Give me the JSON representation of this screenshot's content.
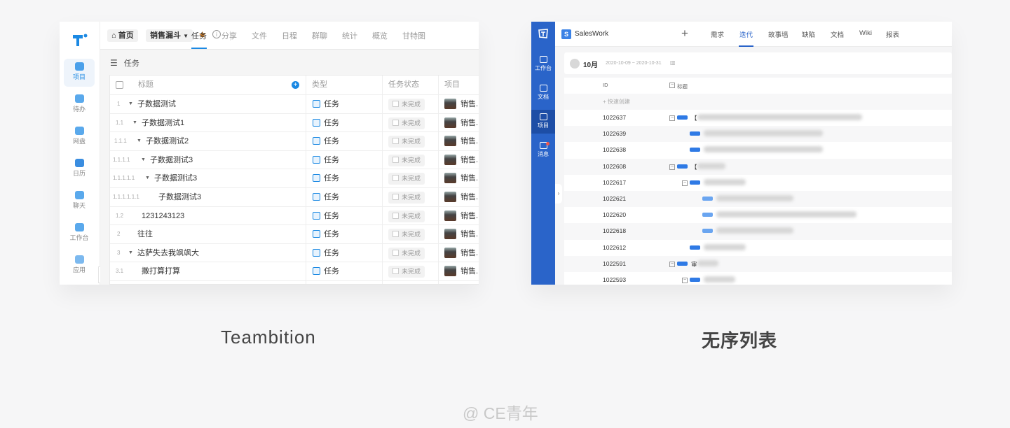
{
  "teambition": {
    "caption": "Teambition",
    "top": {
      "home_label": "首页",
      "project_label": "销售漏斗",
      "tabs": [
        "任务",
        "分享",
        "文件",
        "日程",
        "群聊",
        "统计",
        "概览",
        "甘特图"
      ],
      "active_tab": "任务"
    },
    "sidebar": [
      {
        "label": "项目",
        "icon": "cube-icon",
        "active": true
      },
      {
        "label": "待办",
        "icon": "clipboard-icon"
      },
      {
        "label": "网盘",
        "icon": "folder-icon"
      },
      {
        "label": "日历",
        "icon": "calendar-icon"
      },
      {
        "label": "聊天",
        "icon": "chat-icon"
      },
      {
        "label": "工作台",
        "icon": "monitor-icon"
      },
      {
        "label": "应用",
        "icon": "apps-icon"
      }
    ],
    "subheader": "任务",
    "table": {
      "columns": [
        "标题",
        "类型",
        "任务状态",
        "项目"
      ],
      "rows": [
        {
          "num": "1",
          "expand": true,
          "indent": 0,
          "title": "子数据测试",
          "type": "任务",
          "status": "未完成",
          "project": "销售.."
        },
        {
          "num": "1.1",
          "expand": true,
          "indent": 1,
          "title": "子数据测试1",
          "type": "任务",
          "status": "未完成",
          "project": "销售.."
        },
        {
          "num": "1.1.1",
          "expand": true,
          "indent": 2,
          "title": "子数据测试2",
          "type": "任务",
          "status": "未完成",
          "project": "销售.."
        },
        {
          "num": "1.1.1.1",
          "expand": true,
          "indent": 3,
          "title": "子数据测试3",
          "type": "任务",
          "status": "未完成",
          "project": "销售.."
        },
        {
          "num": "1.1.1.1.1",
          "expand": true,
          "indent": 4,
          "title": "子数据测试3",
          "type": "任务",
          "status": "未完成",
          "project": "销售.."
        },
        {
          "num": "1.1.1.1.1.1",
          "expand": false,
          "indent": 5,
          "title": "子数据测试3",
          "type": "任务",
          "status": "未完成",
          "project": "销售.."
        },
        {
          "num": "1.2",
          "expand": false,
          "indent": 1,
          "title": "1231243123",
          "type": "任务",
          "status": "未完成",
          "project": "销售.."
        },
        {
          "num": "2",
          "expand": false,
          "indent": 0,
          "title": "往往",
          "type": "任务",
          "status": "未完成",
          "project": "销售.."
        },
        {
          "num": "3",
          "expand": true,
          "indent": 0,
          "title": "达萨失去我飒飒大",
          "type": "任务",
          "status": "未完成",
          "project": "销售.."
        },
        {
          "num": "3.1",
          "expand": false,
          "indent": 1,
          "title": "撒打算打算",
          "type": "任务",
          "status": "未完成",
          "project": "销售.."
        }
      ]
    }
  },
  "saleswork": {
    "caption": "无序列表",
    "app_letter": "S",
    "app_name": "SalesWork",
    "tabs": [
      "需求",
      "迭代",
      "故事墙",
      "缺陷",
      "文档",
      "Wiki",
      "报表"
    ],
    "active_tab": "迭代",
    "sidebar": [
      {
        "label": "工作台",
        "icon": "archive-icon"
      },
      {
        "label": "文档",
        "icon": "document-icon"
      },
      {
        "label": "项目",
        "icon": "inbox-icon",
        "active": true
      },
      {
        "label": "消息",
        "icon": "bell-icon",
        "badge": true
      }
    ],
    "iteration": {
      "name": "10月",
      "dates": "2020-10-09 ~ 2020-10-31"
    },
    "list_header": {
      "id": "ID",
      "title": "标题"
    },
    "quick_create": "+ 快速创建",
    "rows": [
      {
        "id": "1022637",
        "level": 0,
        "collapsible": true,
        "tag": "story",
        "title_visible": "【"
      },
      {
        "id": "1022639",
        "level": 1,
        "collapsible": false,
        "tag": "story",
        "title_visible": ""
      },
      {
        "id": "1022638",
        "level": 1,
        "collapsible": false,
        "tag": "story",
        "title_visible": ""
      },
      {
        "id": "1022608",
        "level": 0,
        "collapsible": true,
        "tag": "story",
        "title_visible": "【"
      },
      {
        "id": "1022617",
        "level": 1,
        "collapsible": true,
        "tag": "story",
        "title_visible": ""
      },
      {
        "id": "1022621",
        "level": 2,
        "collapsible": false,
        "tag": "task",
        "title_visible": ""
      },
      {
        "id": "1022620",
        "level": 2,
        "collapsible": false,
        "tag": "task",
        "title_visible": ""
      },
      {
        "id": "1022618",
        "level": 2,
        "collapsible": false,
        "tag": "task",
        "title_visible": ""
      },
      {
        "id": "1022612",
        "level": 1,
        "collapsible": false,
        "tag": "story",
        "title_visible": ""
      },
      {
        "id": "1022591",
        "level": 0,
        "collapsible": true,
        "tag": "story",
        "title_visible": "审"
      },
      {
        "id": "1022593",
        "level": 1,
        "collapsible": true,
        "tag": "story",
        "title_visible": ""
      }
    ]
  },
  "watermark": "@ CE青年"
}
